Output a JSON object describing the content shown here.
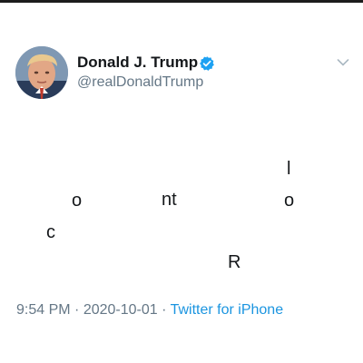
{
  "user": {
    "display_name": "Donald J. Trump",
    "handle": "@realDonaldTrump",
    "verified": true
  },
  "tweet": {
    "glyphs": [
      "l",
      "o",
      "nt",
      "o",
      "c",
      "R"
    ]
  },
  "meta": {
    "time": "9:54 PM",
    "separator1": " · ",
    "date": "2020-10-01",
    "separator2": " · ",
    "source": "Twitter for iPhone"
  },
  "icons": {
    "verified": "verified-badge-icon",
    "menu": "chevron-down-icon"
  },
  "colors": {
    "verified": "#1da1f2",
    "link": "#1b95e0",
    "muted": "#657786",
    "text": "#14171a"
  }
}
